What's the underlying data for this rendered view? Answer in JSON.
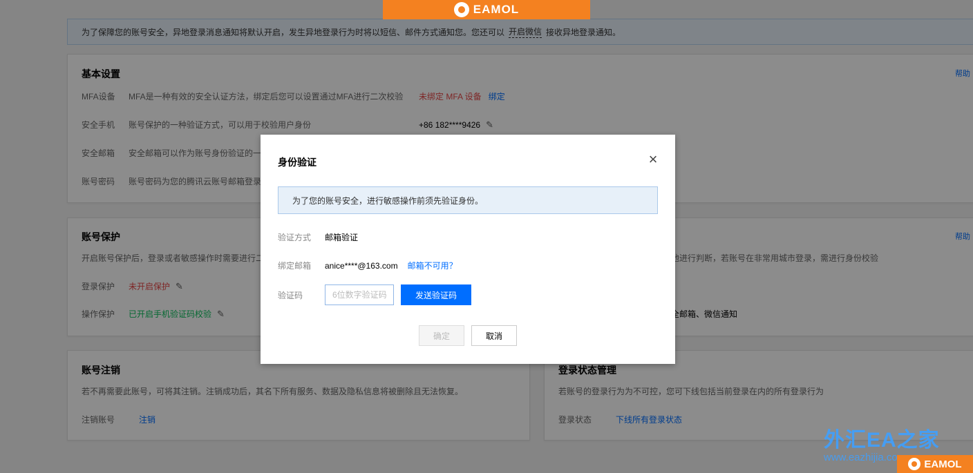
{
  "brand": {
    "name": "EAMOL"
  },
  "notice": {
    "text_before": "为了保障您的账号安全，异地登录消息通知将默认开启，发生异地登录行为时将以短信、邮件方式通知您。您还可以",
    "link": "开启微信",
    "text_after": "接收异地登录通知。"
  },
  "basic": {
    "title": "基本设置",
    "help": "帮助",
    "mfa": {
      "label": "MFA设备",
      "desc": "MFA是一种有效的安全认证方法，绑定后您可以设置通过MFA进行二次校验",
      "status": "未绑定 MFA 设备",
      "action": "绑定"
    },
    "phone": {
      "label": "安全手机",
      "desc": "账号保护的一种验证方式，可以用于校验用户身份",
      "value": "+86 182****9426"
    },
    "email": {
      "label": "安全邮箱",
      "desc": "安全邮箱可以作为账号身份验证的一"
    },
    "password": {
      "label": "账号密码",
      "desc": "账号密码为您的腾讯云账号邮箱登录"
    }
  },
  "protect": {
    "title": "账号保护",
    "help": "帮助",
    "desc": "开启账号保护后，登录或者敏感操作时需要进行二",
    "desc_right": "地进行判断，若账号在非常用城市登录，需进行身份校验",
    "login": {
      "label": "登录保护",
      "status": "未开启保护"
    },
    "operation": {
      "label": "操作保护",
      "status": "已开启手机验证码校验"
    },
    "notify_right": "全邮箱、微信通知"
  },
  "cancel_account": {
    "title": "账号注销",
    "desc": "若不再需要此账号，可将其注销。注销成功后，其名下所有服务、数据及隐私信息将被删除且无法恢复。",
    "label": "注销账号",
    "action": "注销"
  },
  "login_state": {
    "title": "登录状态管理",
    "desc": "若账号的登录行为为不可控，您可下线包括当前登录在内的所有登录行为",
    "label": "登录状态",
    "action": "下线所有登录状态"
  },
  "modal": {
    "title": "身份验证",
    "close": "×",
    "tip": "为了您的账号安全，进行敏感操作前须先验证身份。",
    "method": {
      "label": "验证方式",
      "value": "邮箱验证"
    },
    "bound_email": {
      "label": "绑定邮箱",
      "value": "anice****@163.com",
      "link": "邮箱不可用？"
    },
    "code": {
      "label": "验证码",
      "placeholder": "6位数字验证码",
      "send": "发送验证码"
    },
    "ok": "确定",
    "cancel": "取消"
  },
  "watermark": {
    "name": "外汇EA之家",
    "url": "www.eazhijia.com"
  }
}
